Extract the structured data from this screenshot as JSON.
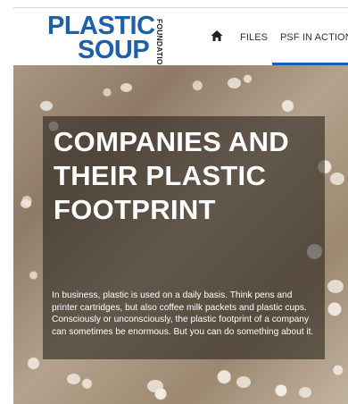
{
  "header": {
    "logo": {
      "line1": "PLASTIC",
      "line2": "SOUP",
      "vertical": "FOUNDATION"
    },
    "nav": {
      "home_icon": "home-icon",
      "items": [
        {
          "label": "FILES"
        },
        {
          "label": "PSF IN ACTION"
        }
      ]
    }
  },
  "hero": {
    "headline": "COMPANIES AND THEIR PLASTIC FOOTPRINT",
    "body": "In business, plastic is used on a daily basis. Think pens and printer cartridges, but also coffee milk packets and plastic cups. Consciously or unconsciously, the plastic footprint of a company can sometimes be enormous. But you can do something about it."
  },
  "colors": {
    "brand_blue": "#1d5fa8",
    "panel_overlay": "rgba(30,26,22,0.55)",
    "text_on_image": "#ffffff"
  }
}
